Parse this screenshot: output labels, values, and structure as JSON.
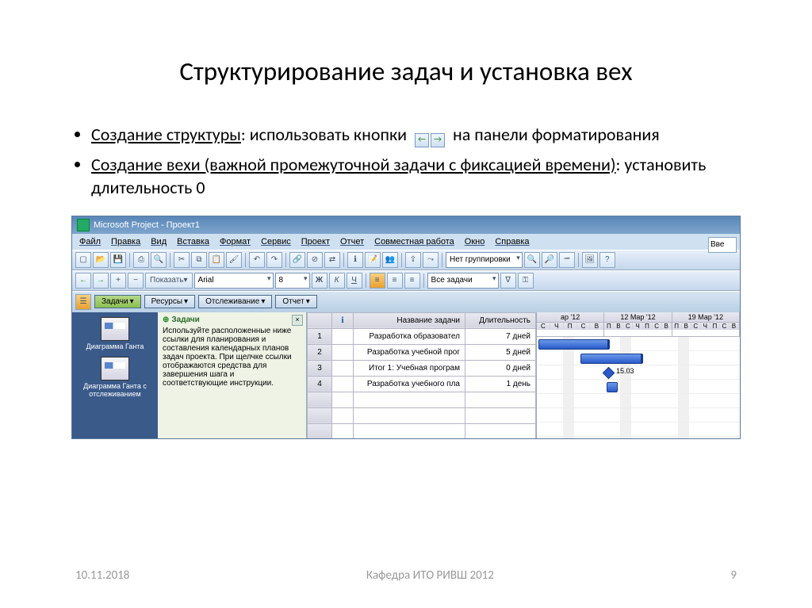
{
  "slide": {
    "title": "Структурирование задач и установка вех",
    "bullet1_under": "Создание структуры",
    "bullet1_rest_a": ": использовать кнопки",
    "bullet1_rest_b": "на панели форматирования",
    "bullet2_under": "Создание вехи (важной промежуточной задачи с фиксацией времени)",
    "bullet2_rest": ": установить длительность 0"
  },
  "footer": {
    "date": "10.11.2018",
    "center": "Кафедра ИТО РИВШ 2012",
    "page": "9"
  },
  "app": {
    "title": "Microsoft Project - Проект1",
    "menu": [
      "Файл",
      "Правка",
      "Вид",
      "Вставка",
      "Формат",
      "Сервис",
      "Проект",
      "Отчет",
      "Совместная работа",
      "Окно",
      "Справка"
    ],
    "search_label": "Вве",
    "toolbar2": {
      "show": "Показать",
      "font": "Arial",
      "size": "8",
      "filter": "Все задачи"
    },
    "toolbar1": {
      "group": "Нет группировки"
    },
    "tabs": [
      "Задачи",
      "Ресурсы",
      "Отслеживание",
      "Отчет"
    ],
    "leftnav": [
      "Диаграмма Ганта",
      "Диаграмма Ганта с отслеживанием"
    ],
    "help": {
      "title": "Задачи",
      "body": "Используйте расположенные ниже ссылки для планирования и составления календарных планов задач проекта. При щелчке ссылки отображаются средства для завершения шага и соответствующие инструкции."
    },
    "grid": {
      "cols": [
        "",
        "Название задачи",
        "Длительность"
      ],
      "rows": [
        {
          "n": "1",
          "name": "Разработка образовател",
          "dur": "7 дней"
        },
        {
          "n": "2",
          "name": "Разработка учебной прог",
          "dur": "5 дней"
        },
        {
          "n": "3",
          "name": "Итог 1: Учебная програм",
          "dur": "0 дней"
        },
        {
          "n": "4",
          "name": "Разработка учебного пла",
          "dur": "1 день"
        }
      ]
    },
    "gantt": {
      "weeks": [
        "ар '12",
        "12 Мар '12",
        "19 Мар '12"
      ],
      "days": "СЧПСВПВСЧПСВПВСЧПСВ",
      "milestone_label": "15.03"
    }
  }
}
